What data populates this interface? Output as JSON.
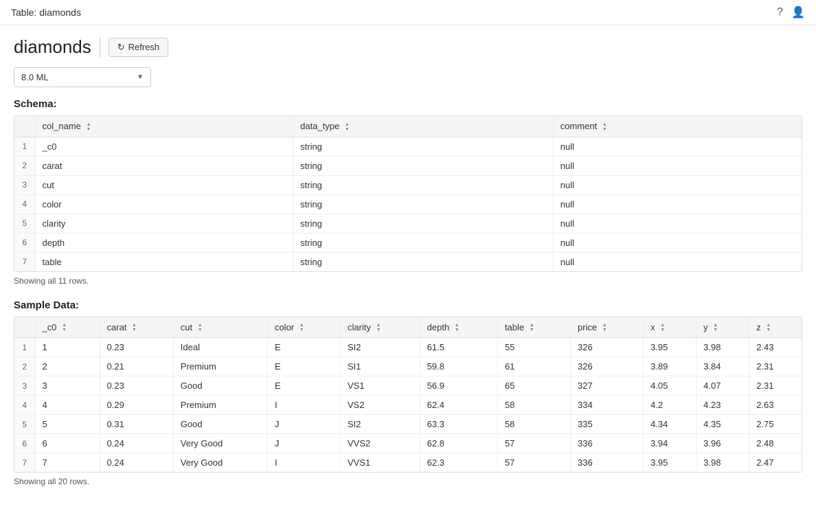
{
  "topbar": {
    "title": "Table: diamonds",
    "help_icon": "?",
    "user_icon": "👤"
  },
  "page": {
    "title": "diamonds",
    "refresh_label": "Refresh"
  },
  "dropdown": {
    "value": "8.0 ML"
  },
  "schema": {
    "section_title": "Schema:",
    "showing_text": "Showing all 11 rows.",
    "columns": [
      "col_name",
      "data_type",
      "comment"
    ],
    "rows": [
      {
        "num": "1",
        "col_name": "_c0",
        "data_type": "string",
        "comment": "null"
      },
      {
        "num": "2",
        "col_name": "carat",
        "data_type": "string",
        "comment": "null"
      },
      {
        "num": "3",
        "col_name": "cut",
        "data_type": "string",
        "comment": "null"
      },
      {
        "num": "4",
        "col_name": "color",
        "data_type": "string",
        "comment": "null"
      },
      {
        "num": "5",
        "col_name": "clarity",
        "data_type": "string",
        "comment": "null"
      },
      {
        "num": "6",
        "col_name": "depth",
        "data_type": "string",
        "comment": "null"
      },
      {
        "num": "7",
        "col_name": "table",
        "data_type": "string",
        "comment": "null"
      }
    ]
  },
  "sample": {
    "section_title": "Sample Data:",
    "showing_text": "Showing all 20 rows.",
    "columns": [
      "_c0",
      "carat",
      "cut",
      "color",
      "clarity",
      "depth",
      "table",
      "price",
      "x",
      "y",
      "z"
    ],
    "rows": [
      {
        "num": "1",
        "_c0": "1",
        "carat": "0.23",
        "cut": "Ideal",
        "color": "E",
        "clarity": "SI2",
        "depth": "61.5",
        "table": "55",
        "price": "326",
        "x": "3.95",
        "y": "3.98",
        "z": "2.43"
      },
      {
        "num": "2",
        "_c0": "2",
        "carat": "0.21",
        "cut": "Premium",
        "color": "E",
        "clarity": "SI1",
        "depth": "59.8",
        "table": "61",
        "price": "326",
        "x": "3.89",
        "y": "3.84",
        "z": "2.31"
      },
      {
        "num": "3",
        "_c0": "3",
        "carat": "0.23",
        "cut": "Good",
        "color": "E",
        "clarity": "VS1",
        "depth": "56.9",
        "table": "65",
        "price": "327",
        "x": "4.05",
        "y": "4.07",
        "z": "2.31"
      },
      {
        "num": "4",
        "_c0": "4",
        "carat": "0.29",
        "cut": "Premium",
        "color": "I",
        "clarity": "VS2",
        "depth": "62.4",
        "table": "58",
        "price": "334",
        "x": "4.2",
        "y": "4.23",
        "z": "2.63"
      },
      {
        "num": "5",
        "_c0": "5",
        "carat": "0.31",
        "cut": "Good",
        "color": "J",
        "clarity": "SI2",
        "depth": "63.3",
        "table": "58",
        "price": "335",
        "x": "4.34",
        "y": "4.35",
        "z": "2.75"
      },
      {
        "num": "6",
        "_c0": "6",
        "carat": "0.24",
        "cut": "Very Good",
        "color": "J",
        "clarity": "VVS2",
        "depth": "62.8",
        "table": "57",
        "price": "336",
        "x": "3.94",
        "y": "3.96",
        "z": "2.48"
      },
      {
        "num": "7",
        "_c0": "7",
        "carat": "0.24",
        "cut": "Very Good",
        "color": "I",
        "clarity": "VVS1",
        "depth": "62.3",
        "table": "57",
        "price": "336",
        "x": "3.95",
        "y": "3.98",
        "z": "2.47"
      }
    ]
  }
}
